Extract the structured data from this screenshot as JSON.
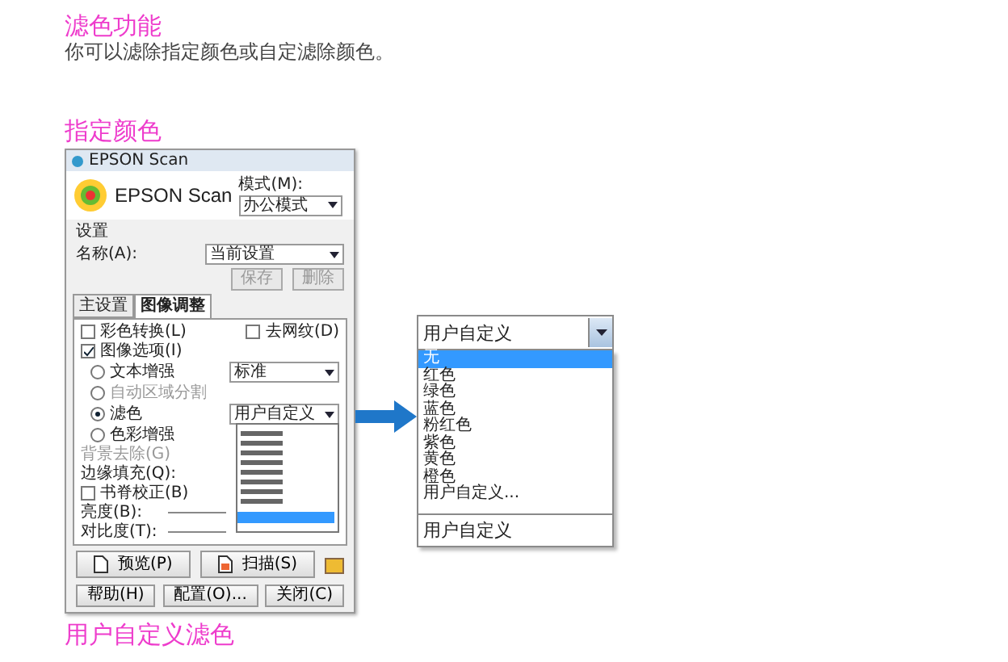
{
  "title": "滤色功能",
  "intro": "你可以滤除指定颜色或自定滤除颜色。",
  "section_title": "指定颜色",
  "figure": {
    "window": {
      "title": "EPSON Scan",
      "brand": "EPSON Scan",
      "mode_label": "模式(M):",
      "mode_value": "办公模式",
      "settings_label": "设置",
      "name_label": "名称(A):",
      "name_value": "当前设置",
      "setting_buttons": [
        {
          "label": "保存",
          "disabled": true
        },
        {
          "label": "删除",
          "disabled": true
        }
      ],
      "tabs": [
        {
          "label": "主设置",
          "selected": false
        },
        {
          "label": "图像调整",
          "selected": true
        }
      ],
      "rows": [
        {
          "kind": "checks",
          "items": [
            {
              "label": "彩色转换(L)",
              "checked": false
            },
            {
              "label": "去网纹(D)",
              "checked": false
            }
          ]
        },
        {
          "kind": "checkbox",
          "label": "图像选项(I)",
          "checked": true
        },
        {
          "kind": "radio",
          "label": "文本增强",
          "selected": false,
          "disabled": false,
          "select": {
            "value": "标准",
            "open": false
          }
        },
        {
          "kind": "radio",
          "label": "自动区域分割",
          "selected": false,
          "disabled": true
        },
        {
          "kind": "radio",
          "label": "滤色",
          "selected": true,
          "disabled": false,
          "select": {
            "value": "用户自定义",
            "open": true
          }
        },
        {
          "kind": "radio",
          "label": "色彩增强",
          "selected": false,
          "disabled": false
        },
        {
          "kind": "note",
          "label": "背景去除(G)",
          "disabled": true
        },
        {
          "kind": "note",
          "label": "边缘填充(Q):",
          "disabled": false
        },
        {
          "kind": "checkbox",
          "label": "书脊校正(B)",
          "checked": false
        },
        {
          "kind": "slider",
          "label": "亮度(B):"
        },
        {
          "kind": "slider",
          "label": "对比度(T):"
        }
      ],
      "action_buttons": [
        "预览(P)",
        "扫描(S)"
      ],
      "bottom_buttons": [
        "帮助(H)",
        "配置(O)...",
        "关闭(C)"
      ]
    },
    "zoom_dropdown": {
      "value": "用户自定义",
      "options": [
        {
          "label": "无",
          "selected": true
        },
        {
          "label": "红色",
          "selected": false
        },
        {
          "label": "绿色",
          "selected": false
        },
        {
          "label": "蓝色",
          "selected": false
        },
        {
          "label": "粉红色",
          "selected": false
        },
        {
          "label": "紫色",
          "selected": false
        },
        {
          "label": "黄色",
          "selected": false
        },
        {
          "label": "橙色",
          "selected": false
        },
        {
          "label": "用户自定义...",
          "selected": false
        }
      ],
      "footer": "用户自定义"
    }
  },
  "next_section_title": "用户自定义滤色"
}
